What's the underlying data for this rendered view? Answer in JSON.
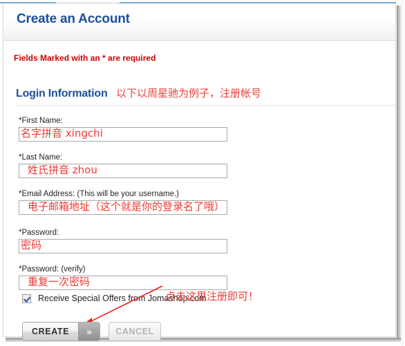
{
  "window": {
    "title": "Create an Account"
  },
  "header": {
    "title": "Create an Account"
  },
  "notes": {
    "required": "Fields Marked with an * are required"
  },
  "section": {
    "title": "Login Information",
    "annotation": "以下以周星驰为例子，注册帐号"
  },
  "form": {
    "fields": [
      {
        "label": "*First Name:",
        "value": "",
        "annotation": "名字拼音  xingchi",
        "name": "first-name"
      },
      {
        "label": "*Last Name:",
        "value": "",
        "annotation": "姓氏拼音   zhou",
        "name": "last-name"
      },
      {
        "label": "*Email Address: (This will be your username.)",
        "value": "",
        "annotation": "电子邮箱地址（这个就是你的登录名了哦）",
        "name": "email-address"
      },
      {
        "label": "*Password:",
        "value": "",
        "annotation": "密码",
        "name": "password"
      },
      {
        "label": "*Password: (verify)",
        "value": "",
        "annotation": "重复一次密码",
        "name": "password-verify"
      }
    ],
    "offers": {
      "label": "Receive Special Offers from Jomashop.com",
      "checked": true
    }
  },
  "annotation": {
    "callout": "点击这里注册即可！"
  },
  "buttons": {
    "create": "CREATE",
    "create_chevron": "»",
    "cancel": "CANCEL"
  },
  "colors": {
    "heading_blue": "#1b4f9c",
    "required_red": "#cc0000",
    "annotation_red": "#ee3a32",
    "checkbox_blue": "#1f4fa0"
  }
}
